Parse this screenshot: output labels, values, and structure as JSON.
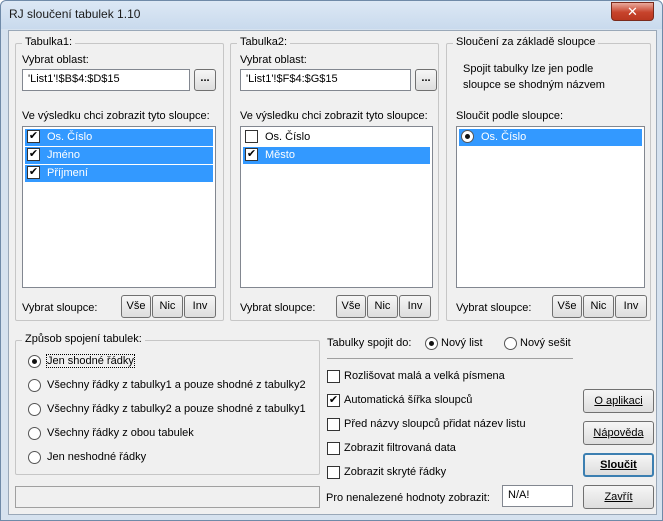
{
  "window": {
    "title": "RJ sloučení tabulek 1.10",
    "close_glyph": "✕"
  },
  "table1": {
    "group_label": "Tabulka1:",
    "range_label": "Vybrat oblast:",
    "range_value": "'List1'!$B$4:$D$15",
    "browse_label": "...",
    "columns_label": "Ve výsledku chci zobrazit tyto sloupce:",
    "columns": [
      {
        "label": "Os. Číslo",
        "checked": true,
        "selected": true
      },
      {
        "label": "Jméno",
        "checked": true,
        "selected": true
      },
      {
        "label": "Příjmení",
        "checked": true,
        "selected": true
      }
    ],
    "select_label": "Vybrat sloupce:",
    "btn_all": "Vše",
    "btn_none": "Nic",
    "btn_inv": "Inv"
  },
  "table2": {
    "group_label": "Tabulka2:",
    "range_label": "Vybrat oblast:",
    "range_value": "'List1'!$F$4:$G$15",
    "browse_label": "...",
    "columns_label": "Ve výsledku chci zobrazit tyto sloupce:",
    "columns": [
      {
        "label": "Os. Číslo",
        "checked": false,
        "selected": false
      },
      {
        "label": "Město",
        "checked": true,
        "selected": true
      }
    ],
    "select_label": "Vybrat sloupce:",
    "btn_all": "Vše",
    "btn_none": "Nic",
    "btn_inv": "Inv"
  },
  "merge": {
    "group_label": "Sloučení za základě sloupce",
    "description_line1": "Spojit tabulky lze jen podle",
    "description_line2": "sloupce se shodným názvem",
    "merge_by_label": "Sloučit podle sloupce:",
    "columns": [
      {
        "label": "Os. Číslo",
        "selected": true
      }
    ],
    "select_label": "Vybrat sloupce:",
    "btn_all": "Vše",
    "btn_none": "Nic",
    "btn_inv": "Inv"
  },
  "join": {
    "group_label": "Způsob spojení tabulek:",
    "options": [
      {
        "label": "Jen shodné řádky",
        "checked": true
      },
      {
        "label": "Všechny řádky z tabulky1 a pouze shodné z tabulky2",
        "checked": false
      },
      {
        "label": "Všechny řádky z tabulky2 a pouze shodné z tabulky1",
        "checked": false
      },
      {
        "label": "Všechny řádky z obou tabulek",
        "checked": false
      },
      {
        "label": "Jen neshodné řádky",
        "checked": false
      }
    ]
  },
  "output": {
    "label": "Tabulky spojit do:",
    "options": [
      {
        "label": "Nový list",
        "checked": true
      },
      {
        "label": "Nový sešit",
        "checked": false
      }
    ]
  },
  "options": [
    {
      "label": "Rozlišovat malá a velká písmena",
      "checked": false
    },
    {
      "label": "Automatická šířka sloupců",
      "checked": true
    },
    {
      "label": "Před názvy sloupců přidat název listu",
      "checked": false
    },
    {
      "label": "Zobrazit filtrovaná data",
      "checked": false
    },
    {
      "label": "Zobrazit skryté řádky",
      "checked": false
    }
  ],
  "unmatched": {
    "label": "Pro nenalezené hodnoty zobrazit:",
    "value": "N/A!"
  },
  "buttons": {
    "about": "O aplikaci",
    "help": "Nápověda",
    "merge": "Sloučit",
    "close": "Zavřít"
  }
}
